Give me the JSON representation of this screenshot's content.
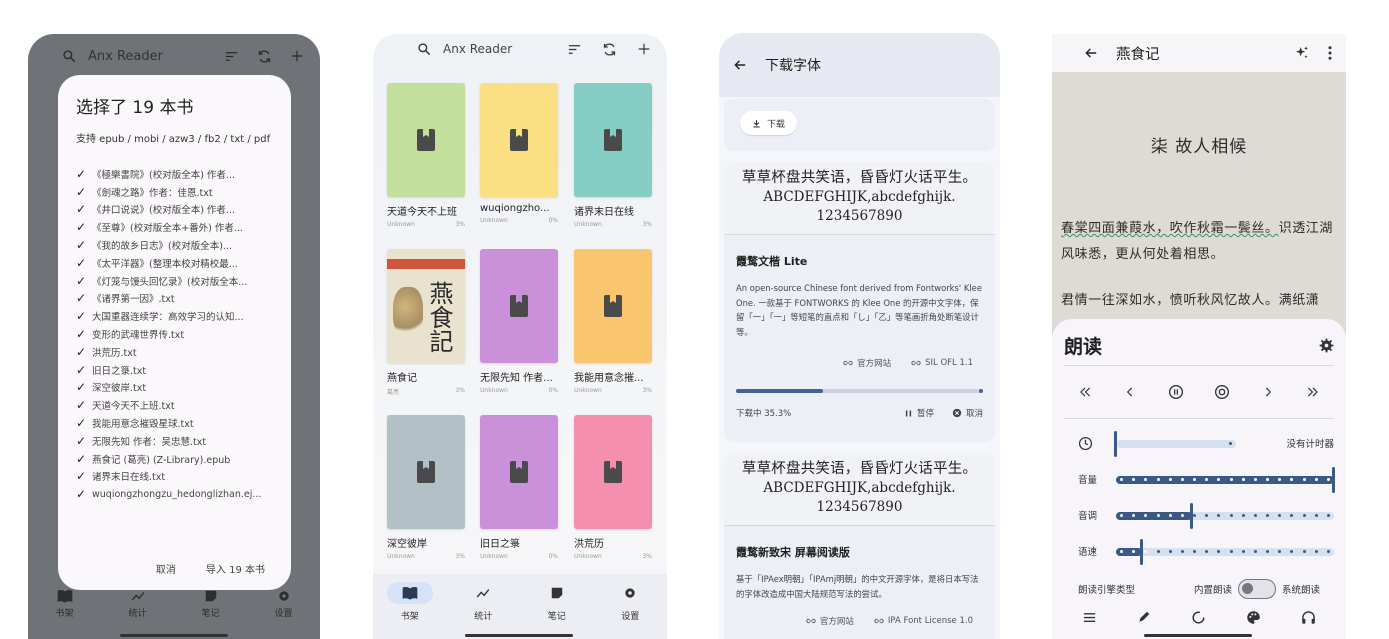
{
  "screen1": {
    "app_title": "Anx Reader",
    "dialog_title": "选择了 19 本书",
    "supported_formats": "支持 epub / mobi / azw3 / fb2 / txt / pdf",
    "files": [
      "《極樂書院》(校对版全本) 作者...",
      "《劍魂之路》作者：佳恩.txt",
      "《井口说说》(校对版全本) 作者...",
      "《至尊》(校对版全本+番外) 作者...",
      "《我的故乡日志》(校对版全本)...",
      "《太平洋器》(整理本校对精校最...",
      "《灯笼与馒头回忆录》(校对版全本...",
      "《诸界第一因》.txt",
      "大国重器连续学：高效学习的认知...",
      "变形的武魂世界传.txt",
      "洪荒历.txt",
      "旧日之箓.txt",
      "深空彼岸.txt",
      "天道今天不上班.txt",
      "我能用意念摧毁星球.txt",
      "无限先知 作者：吴忠慧.txt",
      "燕食记 (葛亮) (Z-Library).epub",
      "诸界末日在线.txt",
      "wuqiongzhongzu_hedonglizhan.ej..."
    ],
    "cancel_label": "取消",
    "import_label": "导入 19 本书",
    "nav": [
      "书架",
      "统计",
      "笔记",
      "设置"
    ]
  },
  "screen2": {
    "app_title": "Anx Reader",
    "books": [
      {
        "title": "天道今天不上班",
        "author": "Unknown",
        "progress": "3%",
        "color": "#c2df9c"
      },
      {
        "title": "wuqiongzho...",
        "author": "Unknown",
        "progress": "0%",
        "color": "#fbe083"
      },
      {
        "title": "诸界末日在线",
        "author": "Unknown",
        "progress": "3%",
        "color": "#86cdc6"
      },
      {
        "title": "燕食记",
        "author": "葛亮",
        "progress": "3%",
        "color": "#e9e2cf",
        "cover_text": "燕食記"
      },
      {
        "title": "无限先知 作者...",
        "author": "Unknown",
        "progress": "0%",
        "color": "#ca90da"
      },
      {
        "title": "我能用意念摧...",
        "author": "Unknown",
        "progress": "3%",
        "color": "#f9c56e"
      },
      {
        "title": "深空彼岸",
        "author": "Unknown",
        "progress": "3%",
        "color": "#b2c1c6"
      },
      {
        "title": "旧日之箓",
        "author": "Unknown",
        "progress": "0%",
        "color": "#ca90da"
      },
      {
        "title": "洪荒历",
        "author": "Unknown",
        "progress": "3%",
        "color": "#f48fb0"
      }
    ],
    "nav": [
      "书架",
      "统计",
      "笔记",
      "设置"
    ]
  },
  "screen3": {
    "title": "下载字体",
    "download_label": "下载",
    "preview_line1": "草草杯盘共笑语，昏昏灯火话平生。",
    "preview_line2": "ABCDEFGHIJK,abcdefghijk.",
    "preview_line3": "1234567890",
    "font1": {
      "name": "霞鹜文楷 Lite",
      "description": "An open-source Chinese font derived from Fontworks' Klee One. 一款基于 FONTWORKS 的 Klee One 的开源中文字体，保留「一」「一」等短笔的直点和「し」「乙」等笔画折角处断笔设计等。",
      "link1": "官方网站",
      "link2": "SIL OFL 1.1",
      "progress": 0.353,
      "status": "下载中 35.3%",
      "pause_label": "暂停",
      "cancel_label": "取消"
    },
    "font2": {
      "name": "霞鹜新致宋 屏幕阅读版",
      "description": "基于「IPAex明朝」「IPAmj明朝」的中文开源字体，是将日本写法的字体改造成中国大陆规范写法的尝试。",
      "link1": "官方网站",
      "link2": "IPA Font License 1.0"
    }
  },
  "screen4": {
    "title": "燕食记",
    "chapter": "柒 故人相候",
    "para1_highlight": "春棠四面兼葭水，吹作秋霜一鬓丝。",
    "para1_rest": "识透江湖风味悉，更从何处着相思。",
    "para2": "君情一往深如水，愤听秋风忆故人。满纸潇",
    "sheet_title": "朗读",
    "timer_label": "没有计时器",
    "timer_level": 0,
    "volume_label": "音量",
    "volume_level": 1.0,
    "pitch_label": "音调",
    "pitch_level": 0.35,
    "rate_label": "语速",
    "rate_level": 0.12,
    "engine_label": "朗读引擎类型",
    "internal_label": "内置朗读",
    "system_label": "系统朗读",
    "accent": "#3a5a85"
  }
}
